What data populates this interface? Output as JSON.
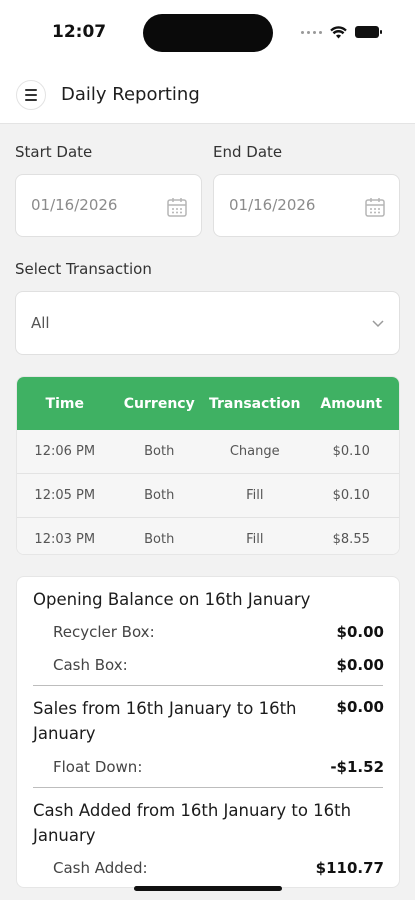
{
  "status_bar": {
    "time": "12:07"
  },
  "header": {
    "title": "Daily Reporting",
    "menu_icon": "hamburger-menu-icon"
  },
  "filters": {
    "start_date_label": "Start Date",
    "start_date_value": "01/16/2026",
    "end_date_label": "End Date",
    "end_date_value": "01/16/2026",
    "transaction_label": "Select Transaction",
    "transaction_value": "All"
  },
  "table": {
    "headers": [
      "Time",
      "Currency",
      "Transaction",
      "Amount"
    ],
    "rows": [
      [
        "12:06 PM",
        "Both",
        "Change",
        "$0.10"
      ],
      [
        "12:05 PM",
        "Both",
        "Fill",
        "$0.10"
      ],
      [
        "12:03 PM",
        "Both",
        "Fill",
        "$8.55"
      ]
    ],
    "header_color": "#3fb163"
  },
  "summary": {
    "opening_heading": "Opening Balance on 16th January",
    "recycler_label": "Recycler Box:",
    "recycler_value": "$0.00",
    "cashbox_label": "Cash Box:",
    "cashbox_value": "$0.00",
    "sales_heading": "Sales from 16th January to 16th January",
    "sales_value": "$0.00",
    "float_label": "Float Down:",
    "float_value": "-$1.52",
    "cash_added_heading": "Cash Added from 16th January to 16th January",
    "cash_added_label": "Cash Added:",
    "cash_added_value": "$110.77"
  }
}
